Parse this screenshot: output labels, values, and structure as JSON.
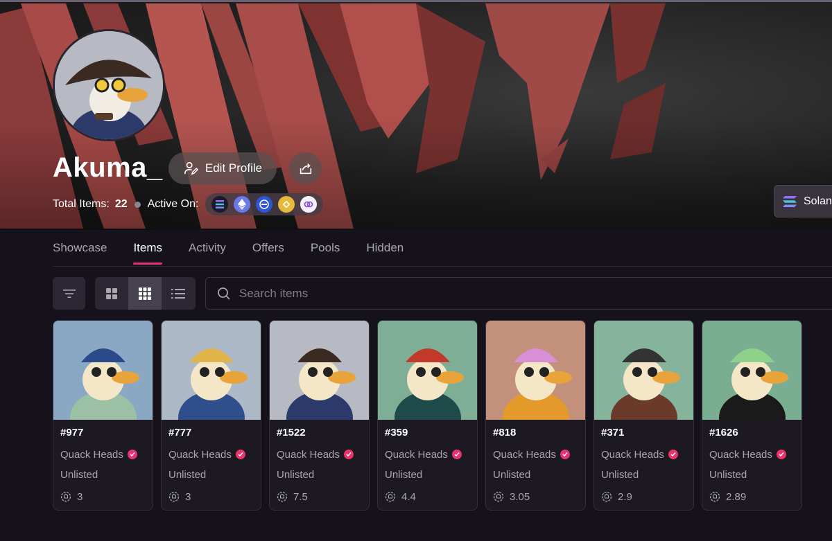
{
  "profile": {
    "username": "Akuma_",
    "edit_label": "Edit Profile",
    "total_items_label": "Total Items:",
    "total_items": "22",
    "active_on_label": "Active On:",
    "chains": [
      "solana-icon",
      "ethereum-icon",
      "chain-icon",
      "bnb-icon",
      "polygon-icon"
    ]
  },
  "network": {
    "label": "Solana"
  },
  "tabs": [
    {
      "label": "Showcase",
      "active": false
    },
    {
      "label": "Items",
      "active": true
    },
    {
      "label": "Activity",
      "active": false
    },
    {
      "label": "Offers",
      "active": false
    },
    {
      "label": "Pools",
      "active": false
    },
    {
      "label": "Hidden",
      "active": false
    }
  ],
  "search": {
    "placeholder": "Search items"
  },
  "colors": {
    "accent": "#e6346f",
    "background": "#15121c",
    "card": "#1c1922"
  },
  "items": [
    {
      "title": "#977",
      "collection": "Quack Heads",
      "status": "Unlisted",
      "price": "3",
      "bg": "#8aa8c4"
    },
    {
      "title": "#777",
      "collection": "Quack Heads",
      "status": "Unlisted",
      "price": "3",
      "bg": "#aeb9c7"
    },
    {
      "title": "#1522",
      "collection": "Quack Heads",
      "status": "Unlisted",
      "price": "7.5",
      "bg": "#b7bac3"
    },
    {
      "title": "#359",
      "collection": "Quack Heads",
      "status": "Unlisted",
      "price": "4.4",
      "bg": "#7fae96"
    },
    {
      "title": "#818",
      "collection": "Quack Heads",
      "status": "Unlisted",
      "price": "3.05",
      "bg": "#c3907c"
    },
    {
      "title": "#371",
      "collection": "Quack Heads",
      "status": "Unlisted",
      "price": "2.9",
      "bg": "#86b39c"
    },
    {
      "title": "#1626",
      "collection": "Quack Heads",
      "status": "Unlisted",
      "price": "2.89",
      "bg": "#7aae93"
    }
  ]
}
